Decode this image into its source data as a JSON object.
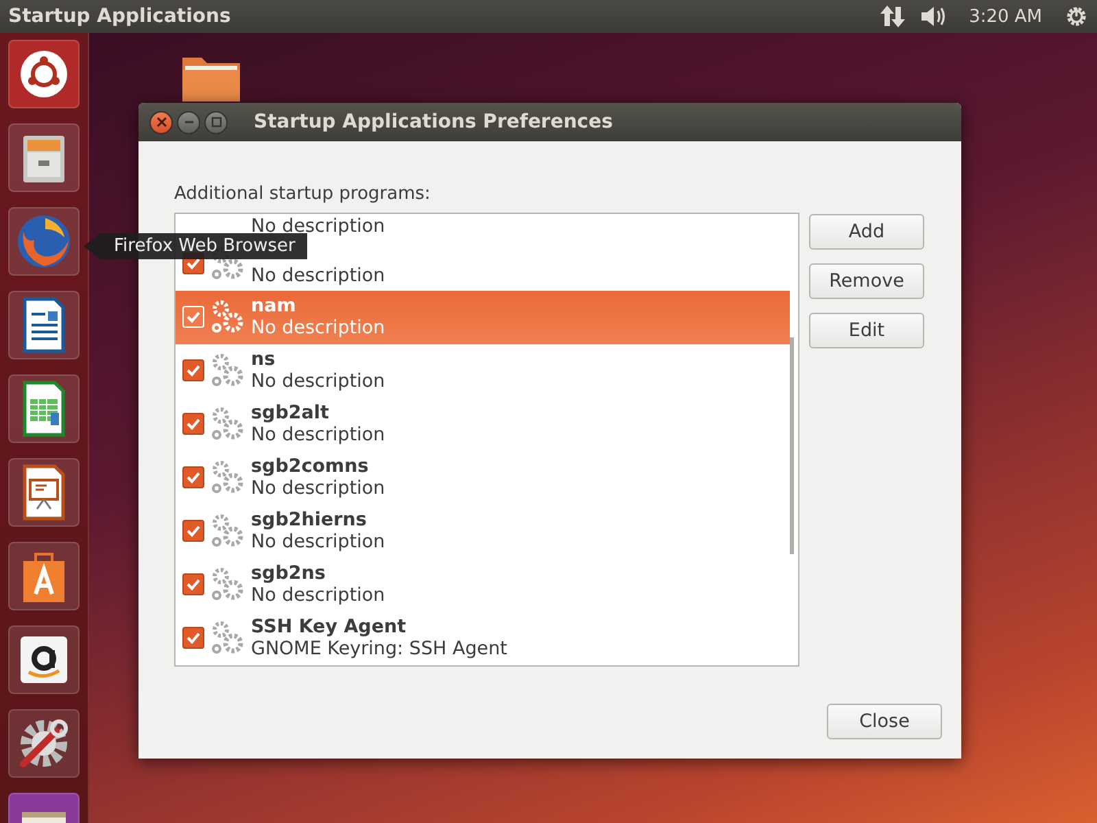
{
  "top_bar": {
    "title": "Startup Applications",
    "clock": "3:20 AM"
  },
  "tooltip": "Firefox Web Browser",
  "window": {
    "title": "Startup Applications Preferences",
    "list_label": "Additional startup programs:",
    "programs": [
      {
        "description": "No description",
        "selected": false
      },
      {
        "description": "No description",
        "checked": true,
        "selected": false
      },
      {
        "name": "nam",
        "description": "No description",
        "checked": true,
        "selected": true
      },
      {
        "name": "ns",
        "description": "No description",
        "checked": true,
        "selected": false
      },
      {
        "name": "sgb2alt",
        "description": "No description",
        "checked": true,
        "selected": false
      },
      {
        "name": "sgb2comns",
        "description": "No description",
        "checked": true,
        "selected": false
      },
      {
        "name": "sgb2hierns",
        "description": "No description",
        "checked": true,
        "selected": false
      },
      {
        "name": "sgb2ns",
        "description": "No description",
        "checked": true,
        "selected": false
      },
      {
        "name": "SSH Key Agent",
        "description": "GNOME Keyring: SSH Agent",
        "checked": true,
        "selected": false
      }
    ],
    "buttons": [
      "Add",
      "Remove",
      "Edit"
    ],
    "close_button": "Close"
  }
}
